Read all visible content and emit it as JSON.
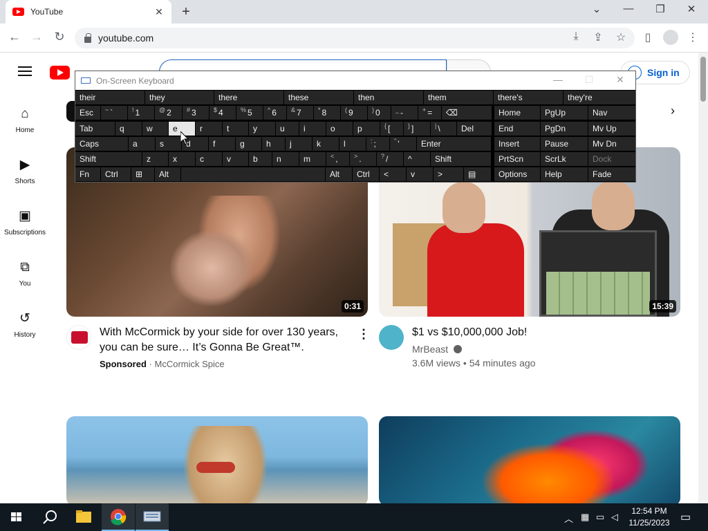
{
  "browser": {
    "tab_title": "YouTube",
    "tab_close": "✕",
    "new_tab": "+",
    "url": "youtube.com"
  },
  "youtube": {
    "search_query": "",
    "sign_in": "Sign in",
    "sidebar": [
      {
        "label": "Home",
        "icon": "home-icon"
      },
      {
        "label": "Shorts",
        "icon": "shorts-icon"
      },
      {
        "label": "Subscriptions",
        "icon": "subscriptions-icon"
      },
      {
        "label": "You",
        "icon": "you-icon"
      },
      {
        "label": "History",
        "icon": "history-icon"
      }
    ],
    "videos": [
      {
        "title_line1": "With McCormick by your side for over 130 years,",
        "title_line2": "you can be sure… It’s Gonna Be Great™.",
        "sponsored": "Sponsored",
        "sep": "·",
        "channel": "McCormick Spice",
        "duration": "0:31"
      },
      {
        "title_line1": "$1 vs $10,000,000 Job!",
        "channel": "MrBeast",
        "stats": "3.6M views • 54 minutes ago",
        "duration": "15:39"
      }
    ]
  },
  "osk": {
    "title": "On-Screen Keyboard",
    "predictions": [
      "their",
      "they",
      "there",
      "these",
      "then",
      "them",
      "there's",
      "they're"
    ],
    "row1": [
      {
        "main": "Esc"
      },
      {
        "sub": "~",
        "main": "`"
      },
      {
        "sub": "!",
        "main": "1"
      },
      {
        "sub": "@",
        "main": "2"
      },
      {
        "sub": "#",
        "main": "3"
      },
      {
        "sub": "$",
        "main": "4"
      },
      {
        "sub": "%",
        "main": "5"
      },
      {
        "sub": "^",
        "main": "6"
      },
      {
        "sub": "&",
        "main": "7"
      },
      {
        "sub": "*",
        "main": "8"
      },
      {
        "sub": "(",
        "main": "9"
      },
      {
        "sub": ")",
        "main": "0"
      },
      {
        "sub": "_",
        "main": "-"
      },
      {
        "sub": "+",
        "main": "="
      },
      {
        "main": "⌫"
      }
    ],
    "row2": [
      "Tab",
      "q",
      "w",
      "e",
      "r",
      "t",
      "y",
      "u",
      "i",
      "o",
      "p",
      "[",
      "]",
      "\\",
      "Del"
    ],
    "row2_subs": [
      "",
      "",
      "",
      "",
      "",
      "",
      "",
      "",
      "",
      "",
      "",
      "{",
      "}",
      "|",
      ""
    ],
    "row3": [
      "Caps",
      "a",
      "s",
      "d",
      "f",
      "g",
      "h",
      "j",
      "k",
      "l",
      ";",
      "'",
      "Enter"
    ],
    "row3_subs": [
      "",
      "",
      "",
      "",
      "",
      "",
      "",
      "",
      "",
      "",
      ":",
      "\"",
      ""
    ],
    "row4": [
      "Shift",
      "z",
      "x",
      "c",
      "v",
      "b",
      "n",
      "m",
      ",",
      ".",
      "/",
      "^",
      "Shift"
    ],
    "row4_subs": [
      "",
      "",
      "",
      "",
      "",
      "",
      "",
      "",
      "<",
      ">",
      "?",
      "",
      ""
    ],
    "row5": [
      "Fn",
      "Ctrl",
      "⊞",
      "Alt",
      "",
      "Alt",
      "Ctrl",
      "<",
      "v",
      ">",
      "▤"
    ],
    "nav": [
      "Home",
      "PgUp",
      "Nav",
      "End",
      "PgDn",
      "Mv Up",
      "Insert",
      "Pause",
      "Mv Dn",
      "PrtScn",
      "ScrLk",
      "Dock",
      "Options",
      "Help",
      "Fade"
    ]
  },
  "taskbar": {
    "time": "12:54 PM",
    "date": "11/25/2023"
  },
  "colors": {
    "yt_red": "#ff0000",
    "link_blue": "#065fd4",
    "osk_bg": "#000000",
    "osk_key": "#262626"
  }
}
